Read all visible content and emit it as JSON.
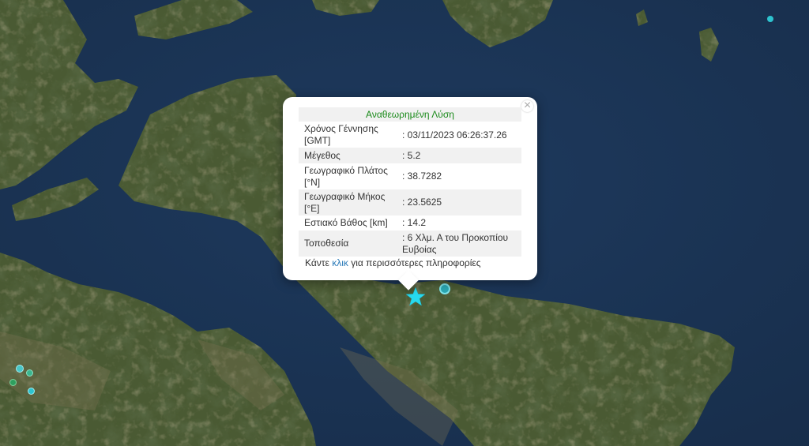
{
  "map": {
    "layer": "satellite imagery",
    "selected_event_icon": "star-icon",
    "marker_color": "#2dc3cf",
    "star_color": "#27d9ef"
  },
  "popup": {
    "title": "Αναθεωρημένη Λύση",
    "close_label": "×",
    "rows": [
      {
        "label": "Χρόνος Γέννησης [GMT]",
        "value": ": 03/11/2023 06:26:37.26"
      },
      {
        "label": "Μέγεθος",
        "value": ": 5.2"
      },
      {
        "label": "Γεωγραφικό Πλάτος [°N]",
        "value": ": 38.7282"
      },
      {
        "label": "Γεωγραφικό Μήκος [°E]",
        "value": ": 23.5625"
      },
      {
        "label": "Εστιακό Βάθος [km]",
        "value": ": 14.2"
      },
      {
        "label": "Τοποθεσία",
        "value": ": 6 Χλμ. Α του Προκοπίου Ευβοίας"
      }
    ],
    "more_prefix": "Κάντε ",
    "more_link": "κλικ",
    "more_suffix": " για περισσότερες πληροφορίες"
  }
}
